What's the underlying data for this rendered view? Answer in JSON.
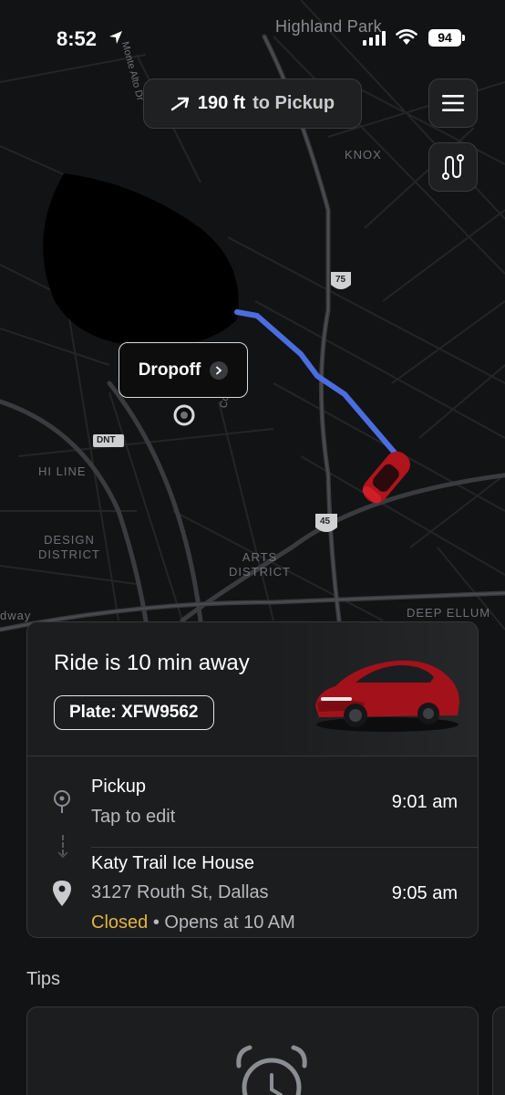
{
  "status_bar": {
    "time": "8:52",
    "battery": "94",
    "neighborhood": "Highland Park"
  },
  "nav": {
    "distance": "190 ft",
    "destination": "to Pickup"
  },
  "map": {
    "dropoff_label": "Dropoff",
    "labels": {
      "knox": "KNOX",
      "hi_line": "HI LINE",
      "design_district": "DESIGN DISTRICT",
      "arts_district": "ARTS DISTRICT",
      "deep_ellum": "DEEP ELLUM",
      "dnt": "DNT",
      "hwy75": "75",
      "hwy45": "45",
      "way": "dway",
      "cole": "Cole",
      "monte": "Monte Alto Dr"
    },
    "route_color": "#4a6ee0",
    "car_color": "#b0141c"
  },
  "ride": {
    "title": "Ride is 10 min away",
    "plate": "Plate: XFW9562"
  },
  "pickup": {
    "label": "Pickup",
    "sub": "Tap to edit",
    "time": "9:01 am"
  },
  "dropoff": {
    "name": "Katy Trail Ice House",
    "address": "3127 Routh St, Dallas",
    "status": "Closed",
    "hours": "• Opens at 10 AM",
    "time": "9:05 am",
    "status_color": "#e2b53f"
  },
  "tips": {
    "label": "Tips"
  }
}
